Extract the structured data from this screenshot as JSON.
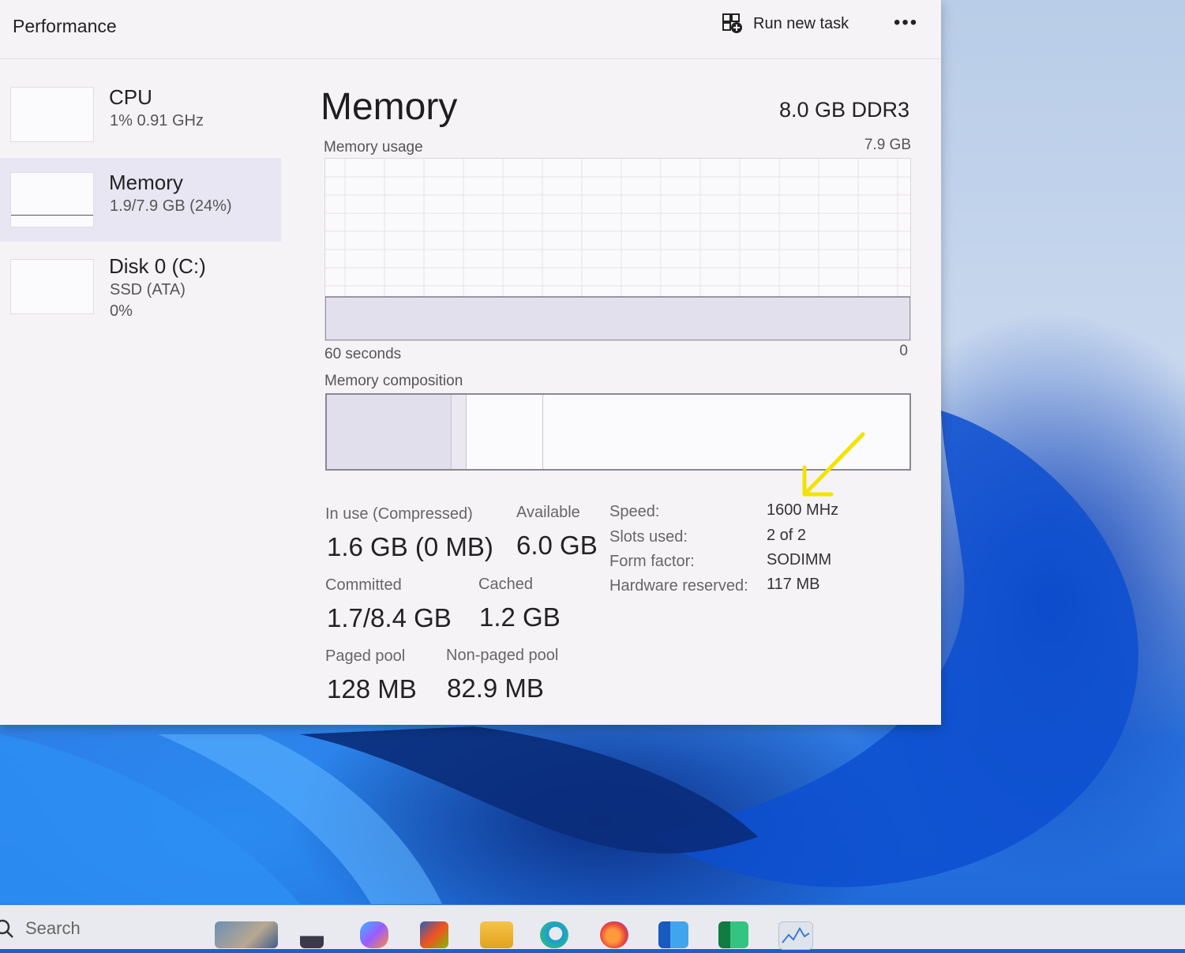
{
  "window": {
    "title": "Performance",
    "run_new_task": "Run new task",
    "more_label": "•••"
  },
  "sidebar": {
    "items": [
      {
        "name": "CPU",
        "sub1": "1%  0.91 GHz",
        "sub2": ""
      },
      {
        "name": "Memory",
        "sub1": "1.9/7.9 GB (24%)",
        "sub2": ""
      },
      {
        "name": "Disk 0 (C:)",
        "sub1": "SSD (ATA)",
        "sub2": "0%"
      }
    ]
  },
  "memory": {
    "title": "Memory",
    "type": "8.0 GB DDR3",
    "usage_label": "Memory usage",
    "usage_max": "7.9 GB",
    "x_left": "60 seconds",
    "x_right": "0",
    "usage_fraction": 0.24,
    "composition_label": "Memory composition",
    "stats": {
      "in_use_label": "In use (Compressed)",
      "in_use_value": "1.6 GB (0 MB)",
      "available_label": "Available",
      "available_value": "6.0 GB",
      "committed_label": "Committed",
      "committed_value": "1.7/8.4 GB",
      "cached_label": "Cached",
      "cached_value": "1.2 GB",
      "paged_label": "Paged pool",
      "paged_value": "128 MB",
      "nonpaged_label": "Non-paged pool",
      "nonpaged_value": "82.9 MB"
    },
    "details": [
      {
        "key": "Speed:",
        "value": "1600 MHz"
      },
      {
        "key": "Slots used:",
        "value": "2 of 2"
      },
      {
        "key": "Form factor:",
        "value": "SODIMM"
      },
      {
        "key": "Hardware reserved:",
        "value": "117 MB"
      }
    ]
  },
  "taskbar": {
    "search_placeholder": "Search",
    "icons": [
      "widgets-icon",
      "file-explorer-pinned-icon",
      "copilot-icon",
      "store-icon",
      "folder-icon",
      "edge-icon",
      "firefox-icon",
      "word-icon",
      "excel-icon",
      "task-manager-icon"
    ]
  },
  "colors": {
    "annotation_arrow": "#f2e300",
    "accent_panel": "#e9e6f3",
    "wallpaper_blue": "#1c66d8"
  }
}
